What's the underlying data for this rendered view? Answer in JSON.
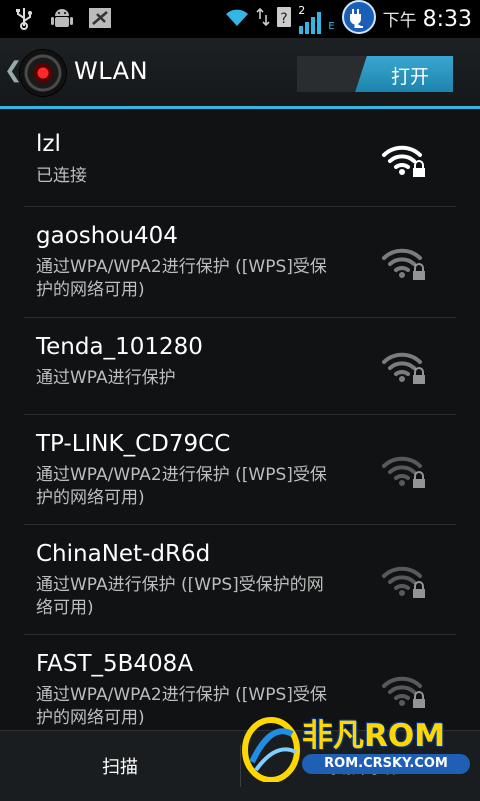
{
  "status_bar": {
    "time_ampm": "下午",
    "time": "8:33",
    "sim_slot": "2",
    "network_type": "E",
    "icons": [
      "usb-icon",
      "android-debug-icon",
      "no-sim-icon",
      "wifi-icon",
      "data-arrows-icon",
      "unknown-sim-icon",
      "signal-icon",
      "charging-icon"
    ]
  },
  "action_bar": {
    "title": "WLAN",
    "toggle_label": "打开"
  },
  "networks": [
    {
      "ssid": "lzl",
      "status": "已连接",
      "signal": "strong",
      "secured": true
    },
    {
      "ssid": "gaoshou404",
      "status": "通过WPA/WPA2进行保护 ([WPS]受保护的网络可用)",
      "signal": "medium",
      "secured": true
    },
    {
      "ssid": "Tenda_101280",
      "status": "通过WPA进行保护",
      "signal": "medium",
      "secured": true
    },
    {
      "ssid": "TP-LINK_CD79CC",
      "status": "通过WPA/WPA2进行保护 ([WPS]受保护的网络可用)",
      "signal": "weak",
      "secured": true
    },
    {
      "ssid": "ChinaNet-dR6d",
      "status": "通过WPA进行保护 ([WPS]受保护的网络可用)",
      "signal": "weak",
      "secured": true
    },
    {
      "ssid": "FAST_5B408A",
      "status": "通过WPA/WPA2进行保护 ([WPS]受保护的网络可用)",
      "signal": "weak",
      "secured": true
    }
  ],
  "bottom_bar": {
    "scan_label": "扫描",
    "add_label": "添加网络"
  },
  "watermark": {
    "brand": "非凡ROM",
    "url": "ROM.CRSKY.COM"
  },
  "colors": {
    "accent": "#33b5e5",
    "background": "#101214",
    "watermark_gold": "#ffd700",
    "watermark_blue": "#1f5fb5"
  }
}
